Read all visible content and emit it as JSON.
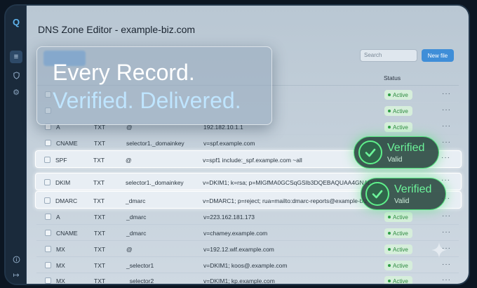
{
  "app": {
    "title": "DNS Zone Editor - example-biz.com"
  },
  "toolbar": {
    "search_placeholder": "Search",
    "new_file_label": "New file"
  },
  "table": {
    "status_header": "Status"
  },
  "hero": {
    "line1": "Every Record.",
    "line2": "Verified. Delivered."
  },
  "badges": [
    {
      "title": "Verified",
      "subtitle": "Valid"
    },
    {
      "title": "Verified",
      "subtitle": "Valid"
    }
  ],
  "rows": [
    {
      "name": "",
      "type": "",
      "host": "",
      "value": "",
      "status": "Active"
    },
    {
      "name": "",
      "type": "",
      "host": "",
      "value": "",
      "status": "Active"
    },
    {
      "name": "A",
      "type": "TXT",
      "host": "@",
      "value": "192.182.10.1.1",
      "status": "Active"
    },
    {
      "name": "CNAME",
      "type": "TXT",
      "host": "selector1._domainkey",
      "value": "v=spf.example.com",
      "status": ""
    },
    {
      "name": "SPF",
      "type": "TXT",
      "host": "@",
      "value": "v=spf1 include:_spf.example.com ~all",
      "status": ""
    },
    {
      "name": "DKIM",
      "type": "TXT",
      "host": "selector1._domainkey",
      "value": "v=DKIM1; k=rsa; p=MIGfMA0GCSqGSIb3DQEBAQUAA4GNADCB",
      "status": ""
    },
    {
      "name": "DMARC",
      "type": "TXT",
      "host": "_dmarc",
      "value": "v=DMARC1; p=reject; rua=mailto:dmarc-reports@example-biz",
      "status": ""
    },
    {
      "name": "A",
      "type": "TXT",
      "host": "_dmarc",
      "value": "v=223.162.181.173",
      "status": "Active"
    },
    {
      "name": "CNAME",
      "type": "TXT",
      "host": "_dmarc",
      "value": "v=chamey.example.com",
      "status": "Active"
    },
    {
      "name": "MX",
      "type": "TXT",
      "host": "@",
      "value": "v=192.12.wlf.example.com",
      "status": "Active"
    },
    {
      "name": "MX",
      "type": "TXT",
      "host": "_selector1",
      "value": "v=DKIM1; koos@.example.com",
      "status": "Active"
    },
    {
      "name": "MX",
      "type": "TXT",
      "host": "_selector2",
      "value": "v=DKIM1; kp.example.com",
      "status": "Active"
    }
  ],
  "icons": {
    "rail": [
      "logo-icon",
      "list-icon",
      "shield-icon",
      "gear-icon",
      "info-icon",
      "logout-icon"
    ],
    "status_dot": "dot-icon",
    "row_menu": "more-icon",
    "badge": "check-circle-icon"
  },
  "colors": {
    "accent": "#3f8ed8",
    "active_badge_bg": "#d6eedb",
    "active_badge_text": "#2d8a3f",
    "verified_glow": "#4fe07a",
    "hero_line2": "#bfe5ff"
  }
}
